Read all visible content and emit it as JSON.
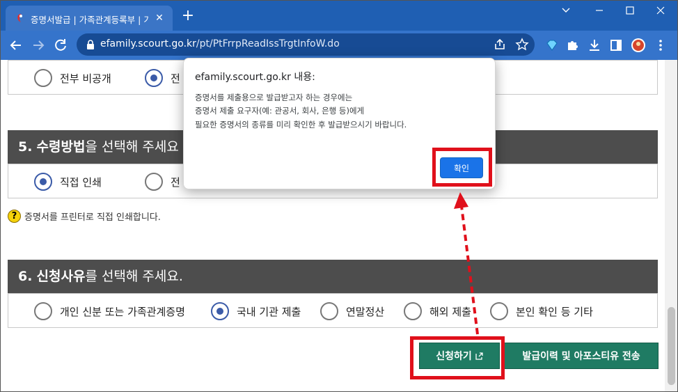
{
  "window": {
    "tab_title": "증명서발급 | 가족관계등록부 | 가족관계",
    "new_tab_label": "+",
    "close_tab_label": "✕"
  },
  "address_bar": {
    "host": "efamily.scourt.go.kr",
    "path": "/pt/PtFrrpReadIssTrgtInfoW.do"
  },
  "top_section": {
    "options": [
      {
        "label": "전부 비공개",
        "selected": false
      },
      {
        "label": "전",
        "selected": true
      }
    ]
  },
  "section5": {
    "number": "5.",
    "title_bold": "수령방법",
    "title_rest": "을 선택해 주세요",
    "options": [
      {
        "label": "직접 인쇄",
        "selected": true
      },
      {
        "label": "전",
        "selected": false
      }
    ],
    "help_mark": "?",
    "help_text": "증명서를 프린터로 직접 인쇄합니다."
  },
  "section6": {
    "number": "6.",
    "title_bold": "신청사유",
    "title_rest": "를 선택해 주세요.",
    "options": [
      {
        "label": "개인 신분 또는 가족관계증명",
        "selected": false
      },
      {
        "label": "국내 기관 제출",
        "selected": true
      },
      {
        "label": "연말정산",
        "selected": false
      },
      {
        "label": "해외 제출",
        "selected": false
      },
      {
        "label": "본인 확인 등 기타",
        "selected": false
      }
    ]
  },
  "buttons": {
    "apply": "신청하기",
    "history": "발급이력 및 아포스티유 전송"
  },
  "dialog": {
    "title": "efamily.scourt.go.kr 내용:",
    "line1": "증명서를 제출용으로 발급받고자 하는 경우에는",
    "line2": "증명서 제출 요구자(예: 관공서, 회사, 은행 등)에게",
    "line3": "필요한 증명서의 종류를 미리 확인한 후 발급받으시기 바랍니다.",
    "ok": "확인"
  },
  "colors": {
    "chrome_title": "#1f5fb3",
    "chrome_toolbar": "#3574cb",
    "section_header": "#4d4d4d",
    "radio_selected": "#3b5ba8",
    "green_button": "#1f7b63",
    "dialog_button": "#1a73e8",
    "highlight": "#e0101b"
  },
  "icons": [
    "back-arrow-icon",
    "forward-arrow-icon",
    "reload-icon",
    "lock-icon",
    "share-icon",
    "star-icon",
    "diamond-extension-icon",
    "puzzle-extension-icon",
    "download-icon",
    "sidepanel-icon",
    "profile-avatar-icon",
    "kebab-menu-icon",
    "external-link-icon",
    "help-icon"
  ]
}
